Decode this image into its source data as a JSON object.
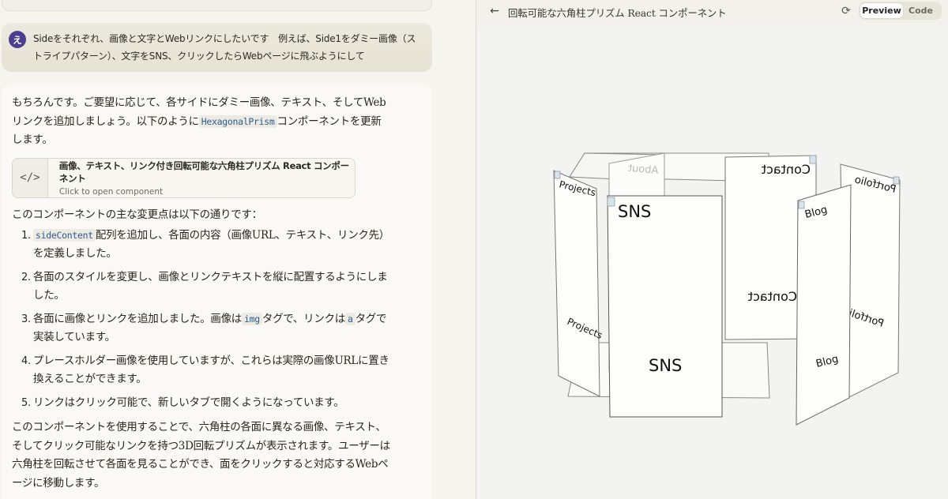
{
  "user_message": {
    "avatar_initial": "え",
    "text": "Sideをそれぞれ、画像と文字とWebリンクにしたいです　例えば、Side1をダミー画像（ストライプパターン）、文字をSNS、クリックしたらWebページに飛ぶようにして"
  },
  "assistant": {
    "intro_before": "もちろんです。ご要望に応じて、各サイドにダミー画像、テキスト、そしてWebリンクを追加しましょう。以下のように",
    "intro_code": "HexagonalPrism",
    "intro_after": "コンポーネントを更新します。",
    "artifact": {
      "icon": "</>",
      "title": "画像、テキスト、リンク付き回転可能な六角柱プリズム React コンポーネント",
      "subtitle": "Click to open component"
    },
    "changes_intro": "このコンポーネントの主な変更点は以下の通りです：",
    "changes": [
      {
        "num": "1.",
        "code": "sideContent",
        "text": "配列を追加し、各面の内容（画像URL、テキスト、リンク先）を定義しました。"
      },
      {
        "num": "2.",
        "text": "各面のスタイルを変更し、画像とリンクテキストを縦に配置するようにしました。"
      },
      {
        "num": "3.",
        "before": "各面に画像とリンクを追加しました。画像は",
        "code1": "img",
        "mid": "タグで、リンクは",
        "code2": "a",
        "after": "タグで実装しています。"
      },
      {
        "num": "4.",
        "text": "プレースホルダー画像を使用していますが、これらは実際の画像URLに置き換えることができます。"
      },
      {
        "num": "5.",
        "text": "リンクはクリック可能で、新しいタブで開くようになっています。"
      }
    ],
    "closing": "このコンポーネントを使用することで、六角柱の各面に異なる画像、テキスト、そしてクリック可能なリンクを持つ3D回転プリズムが表示されます。ユーザーは六角柱を回転させて各面を見ることができ、面をクリックすると対応するWebページに移動します。"
  },
  "preview": {
    "back_icon": "arrow-left-icon",
    "title": "回転可能な六角柱プリズム React コンポーネント",
    "refresh_icon": "refresh-icon",
    "tabs": {
      "preview": "Preview",
      "code": "Code"
    },
    "active_tab": "Preview",
    "faces": {
      "sns": "SNS",
      "projects": "Projects",
      "about": "About",
      "contact": "Contact",
      "blog": "Blog",
      "portfolio": "Portfolio"
    }
  }
}
